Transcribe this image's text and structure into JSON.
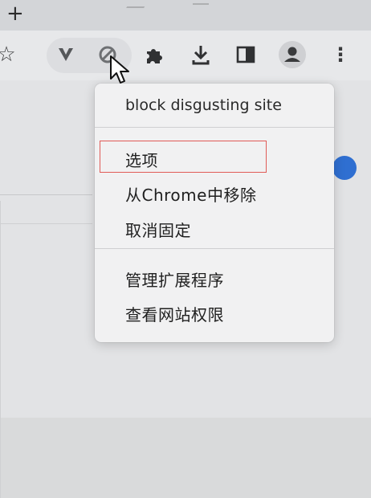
{
  "tabstrip": {
    "new_tab_label": "+"
  },
  "toolbar": {
    "icons": [
      {
        "name": "bookmark-star-icon",
        "glyph": "☆"
      },
      {
        "name": "vpn-extension-icon",
        "glyph": "V"
      },
      {
        "name": "block-site-extension-icon",
        "glyph": "⊘"
      },
      {
        "name": "extensions-puzzle-icon",
        "glyph": ""
      },
      {
        "name": "download-icon",
        "glyph": ""
      },
      {
        "name": "side-panel-icon",
        "glyph": ""
      },
      {
        "name": "profile-avatar-icon",
        "glyph": ""
      },
      {
        "name": "more-menu-icon",
        "glyph": "⋮"
      }
    ]
  },
  "menu": {
    "title": "block disgusting site",
    "items_group1": [
      {
        "label": "选项",
        "highlighted": true
      },
      {
        "label": "从Chrome中移除"
      },
      {
        "label": "取消固定"
      }
    ],
    "items_group2": [
      {
        "label": "管理扩展程序"
      },
      {
        "label": "查看网站权限"
      }
    ]
  },
  "colors": {
    "highlight_border": "#e05b57",
    "accent_dot": "#2f6fd1"
  }
}
